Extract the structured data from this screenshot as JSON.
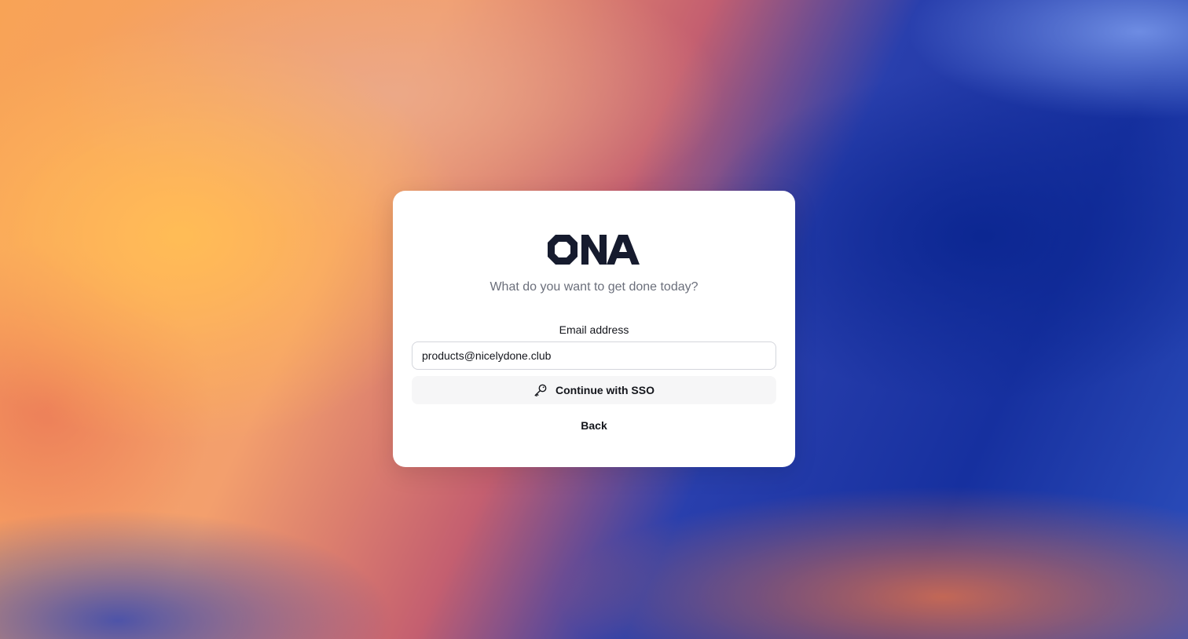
{
  "brand": {
    "logo_text": "ONA",
    "logo_color": "#161b2e"
  },
  "login": {
    "tagline": "What do you want to get done today?",
    "email_label": "Email address",
    "email_value": "products@nicelydone.club",
    "sso_icon": "key-icon",
    "sso_label": "Continue with SSO",
    "back_label": "Back"
  },
  "colors": {
    "card_background": "#ffffff",
    "text_primary": "#14161c",
    "text_secondary": "#6b6f7b",
    "sso_button_background": "#f6f6f7"
  }
}
